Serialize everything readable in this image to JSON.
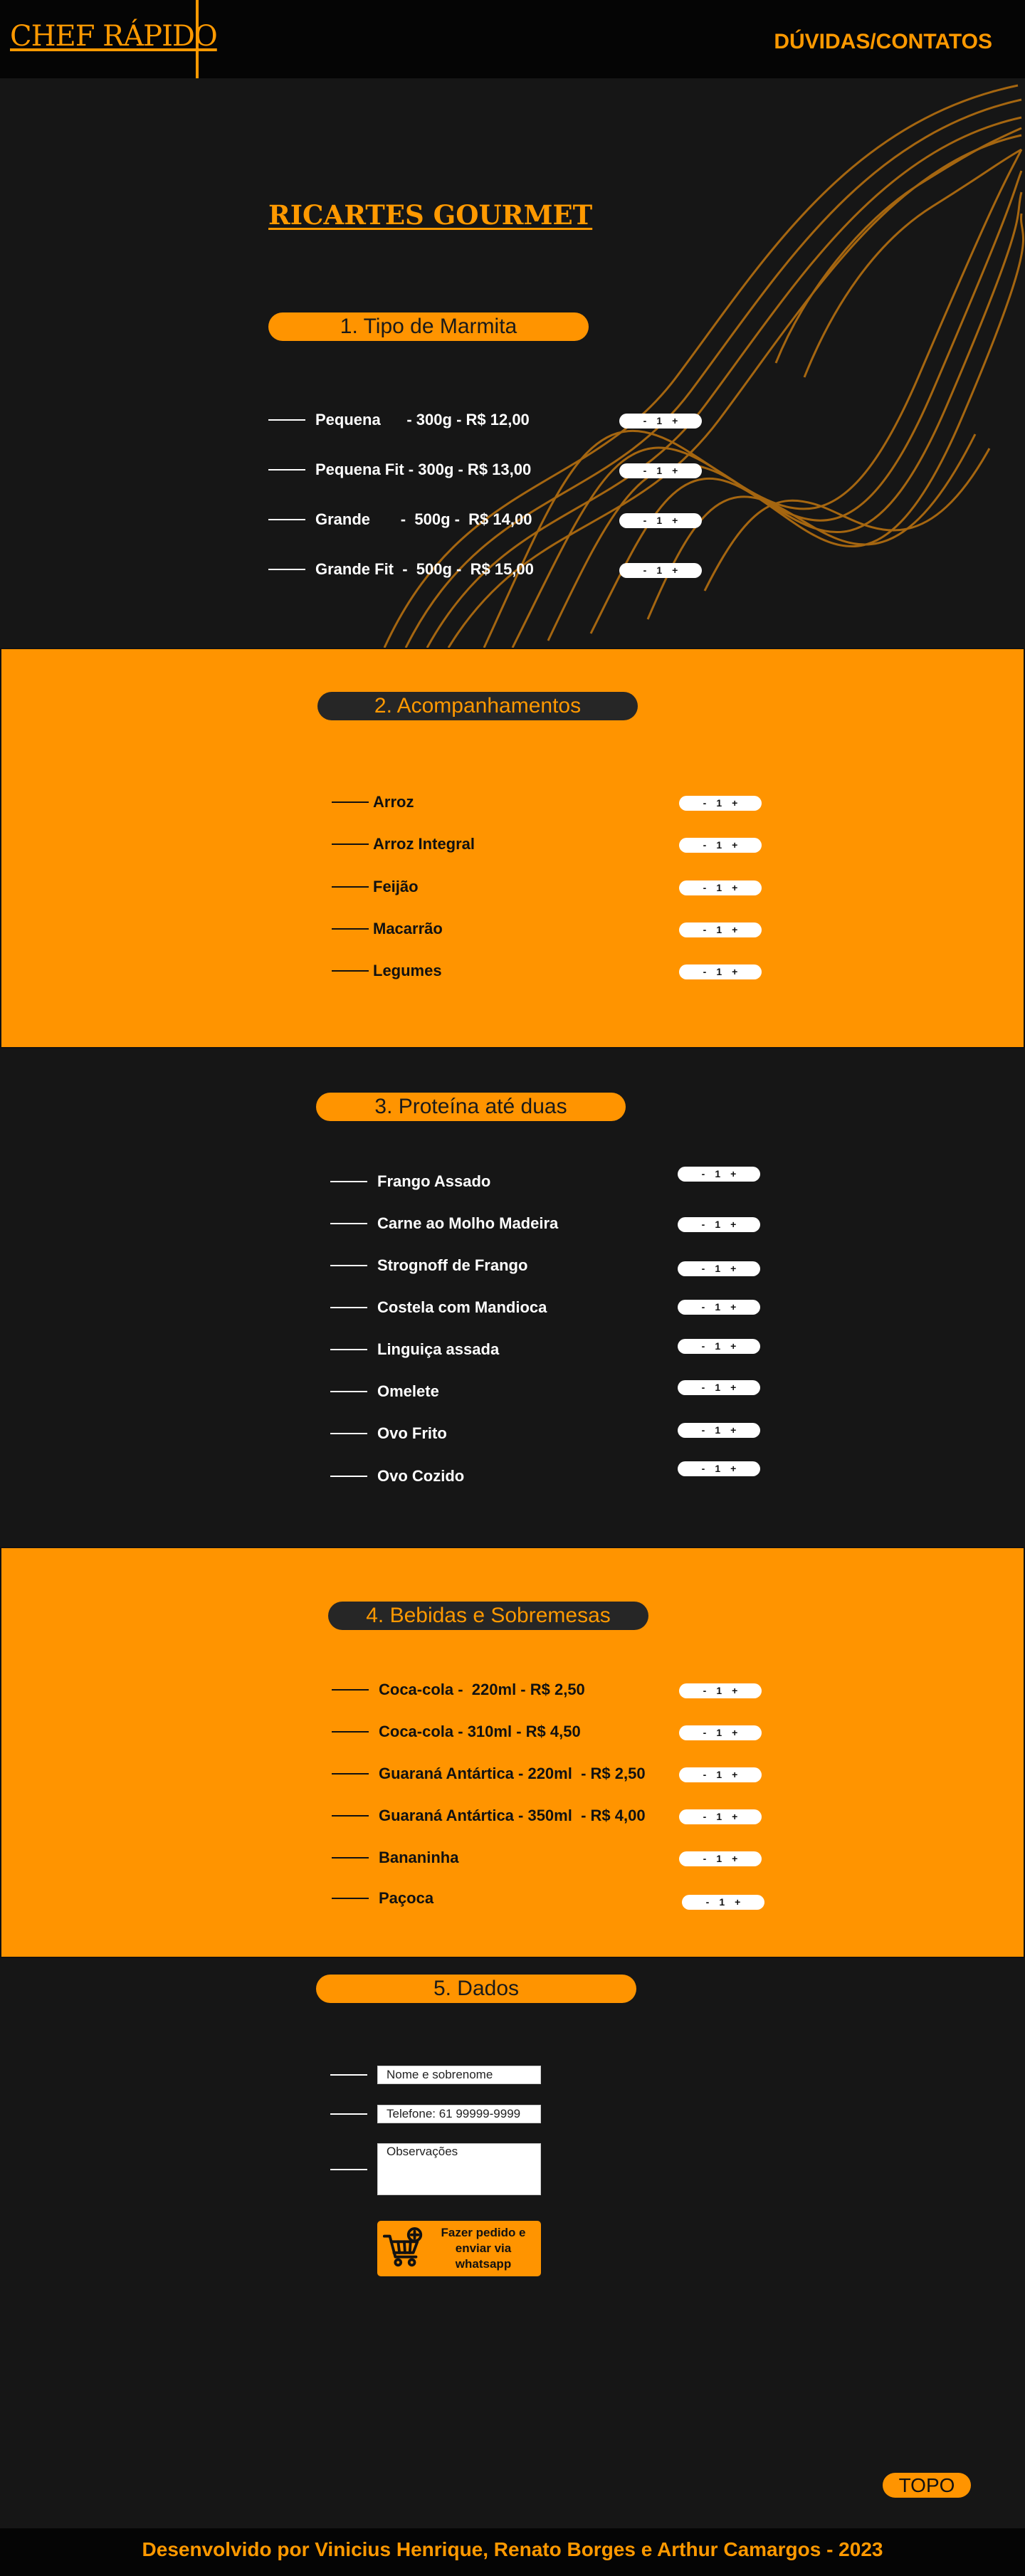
{
  "header": {
    "logo": "CHEF RÁPIDO",
    "contact_link": "DÚVIDAS/CONTATOS"
  },
  "brand": "RICARTES GOURMET",
  "stepper": {
    "minus": "-",
    "value": "1",
    "plus": "+"
  },
  "sections": {
    "tipo": {
      "title": "1. Tipo de Marmita",
      "items": [
        "Pequena      - 300g - R$ 12,00",
        "Pequena Fit - 300g - R$ 13,00",
        "Grande       -  500g -  R$ 14,00",
        "Grande Fit  -  500g -  R$ 15,00"
      ]
    },
    "acompanhamentos": {
      "title": "2. Acompanhamentos",
      "items": [
        "Arroz",
        "Arroz Integral",
        "Feijão",
        "Macarrão",
        "Legumes"
      ]
    },
    "proteina": {
      "title": "3. Proteína até duas",
      "items": [
        "Frango Assado",
        "Carne ao Molho Madeira",
        "Strognoff de Frango",
        "Costela com Mandioca",
        "Linguiça assada",
        "Omelete",
        "Ovo Frito",
        "Ovo Cozido"
      ]
    },
    "bebidas": {
      "title": "4. Bebidas e Sobremesas",
      "items": [
        "Coca-cola -  220ml - R$ 2,50",
        "Coca-cola - 310ml - R$ 4,50",
        "Guaraná Antártica - 220ml  - R$ 2,50",
        "Guaraná Antártica - 350ml  - R$ 4,00",
        "Bananinha",
        "Paçoca"
      ]
    },
    "dados": {
      "title": "5. Dados",
      "name_placeholder": "Nome e sobrenome",
      "phone_placeholder": "Telefone: 61 99999-9999",
      "obs_placeholder": "Observações",
      "order_button": "Fazer pedido e enviar via whatsapp"
    }
  },
  "top_button": "TOPO",
  "footer": "Desenvolvido por Vinicius Henrique, Renato Borges e Arthur Camargos - 2023",
  "colors": {
    "accent": "#ff9400",
    "dark": "#161616",
    "header": "#050505"
  },
  "icons": {
    "cart": "shopping-cart-add-icon"
  }
}
